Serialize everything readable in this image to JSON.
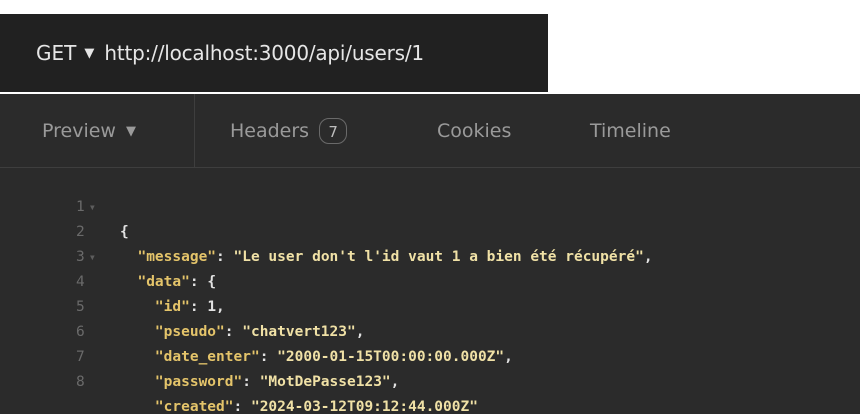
{
  "request": {
    "method": "GET",
    "url": "http://localhost:3000/api/users/1"
  },
  "tabs": {
    "preview": "Preview",
    "headers": "Headers",
    "headers_count": "7",
    "cookies": "Cookies",
    "timeline": "Timeline"
  },
  "code": {
    "lines": [
      {
        "n": "1",
        "open": "{"
      },
      {
        "n": "2",
        "key": "\"message\"",
        "value": "\"Le user don't l'id vaut 1 a bien été récupéré\"",
        "tail": ","
      },
      {
        "n": "3",
        "key": "\"data\"",
        "open": "{"
      },
      {
        "n": "4",
        "key": "\"id\"",
        "value": "1",
        "tail": ","
      },
      {
        "n": "5",
        "key": "\"pseudo\"",
        "value": "\"chatvert123\"",
        "tail": ","
      },
      {
        "n": "6",
        "key": "\"date_enter\"",
        "value": "\"2000-01-15T00:00:00.000Z\"",
        "tail": ","
      },
      {
        "n": "7",
        "key": "\"password\"",
        "value": "\"MotDePasse123\"",
        "tail": ","
      },
      {
        "n": "8",
        "key": "\"created\"",
        "value": "\"2024-03-12T09:12:44.000Z\"",
        "tail": ""
      }
    ]
  },
  "colors": {
    "url_bar_bg": "#212121",
    "panel_bg": "#2b2b2b",
    "json_key": "#e4c46a",
    "json_string": "#f0e1a6"
  }
}
